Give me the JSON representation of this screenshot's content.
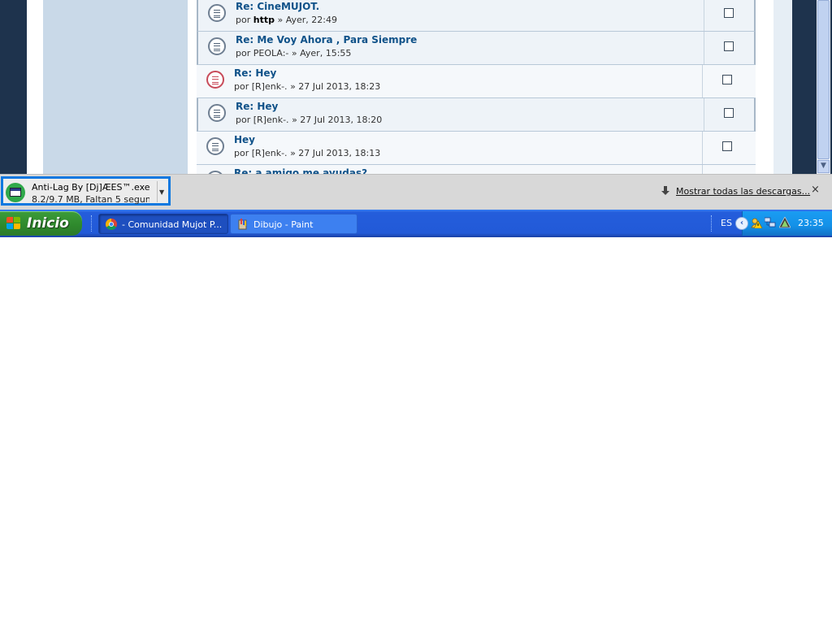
{
  "forum": {
    "topics": [
      {
        "title": "Re: CineMUJOT.",
        "by": "por",
        "author": "http",
        "author_bold": true,
        "sep": "»",
        "date": "Ayer, 22:49",
        "highlight": true,
        "icon": "topic-read-icon"
      },
      {
        "title": "Re: Me Voy Ahora , Para Siempre",
        "by": "por",
        "author": "PEOLA:-",
        "author_bold": false,
        "sep": "»",
        "date": "Ayer, 15:55",
        "highlight": true,
        "icon": "topic-read-icon"
      },
      {
        "title": "Re: Hey",
        "by": "por",
        "author": "[R]enk-.",
        "author_bold": false,
        "sep": "»",
        "date": "27 Jul 2013, 18:23",
        "highlight": false,
        "icon": "topic-hot-icon"
      },
      {
        "title": "Re: Hey",
        "by": "por",
        "author": "[R]enk-.",
        "author_bold": false,
        "sep": "»",
        "date": "27 Jul 2013, 18:20",
        "highlight": true,
        "icon": "topic-read-icon"
      },
      {
        "title": "Hey",
        "by": "por",
        "author": "[R]enk-.",
        "author_bold": false,
        "sep": "»",
        "date": "27 Jul 2013, 18:13",
        "highlight": false,
        "icon": "topic-read-icon"
      },
      {
        "title": "Re: a amigo me ayudas?",
        "by": "",
        "author": "",
        "author_bold": false,
        "sep": "",
        "date": "",
        "highlight": false,
        "icon": "topic-read-icon"
      }
    ]
  },
  "download_bar": {
    "file_name": "Anti-Lag By [Dj]ÆES™.exe",
    "status": "8.2/9.7 MB, Faltan 5 segun...",
    "show_all": "Mostrar todas las descargas...",
    "close": "×"
  },
  "taskbar": {
    "start_label": "Inicio",
    "tasks": [
      {
        "label": "- Comunidad Mujot P...",
        "icon": "chrome-icon",
        "active": true
      },
      {
        "label": "Dibujo - Paint",
        "icon": "paint-icon",
        "active": false
      }
    ],
    "language": "ES",
    "clock": "23:35"
  },
  "colors": {
    "link": "#105289",
    "download_focus": "#0d78e0",
    "taskbar": "#245ddb",
    "start": "#3c9c3b"
  }
}
